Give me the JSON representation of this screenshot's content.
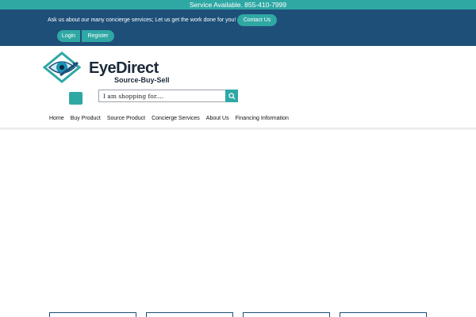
{
  "topbar": {
    "text": "Service Available. 855-410-7999"
  },
  "header": {
    "promo": "Ask us about our many concierge services; Let us get the work done for you!",
    "contact_label": "Contact Us",
    "login_label": "Login",
    "register_label": "Register"
  },
  "logo": {
    "name": "EyeDirect",
    "tagline": "Source-Buy-Sell"
  },
  "search": {
    "placeholder": "I am shopping for...."
  },
  "nav": {
    "items": [
      "Home",
      "Buy Product",
      "Source Product",
      "Concierge Services",
      "About Us",
      "Financing Information"
    ]
  },
  "icons": {
    "search": "search-icon",
    "menu": "menu-icon",
    "logo": "eye-logo-icon"
  },
  "colors": {
    "teal": "#2fa8a4",
    "navy": "#1d4f79",
    "text_dark": "#1b2a3a"
  }
}
